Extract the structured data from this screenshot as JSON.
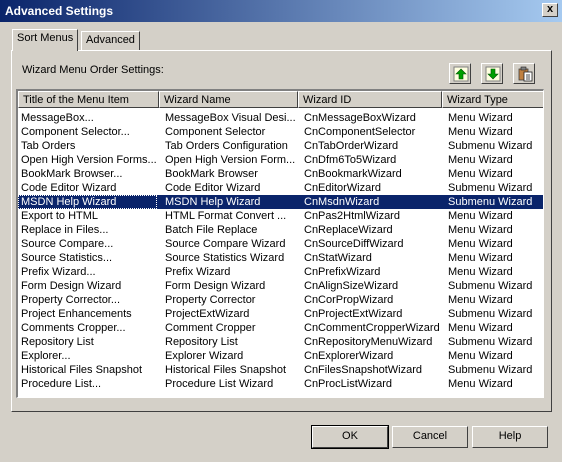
{
  "window": {
    "title": "Advanced Settings",
    "close_glyph": "x"
  },
  "tabs": [
    {
      "label": "Sort Menus",
      "active": true
    },
    {
      "label": "Advanced",
      "active": false
    }
  ],
  "section_label": "Wizard Menu Order Settings:",
  "toolbar": {
    "icons": [
      "move-up-icon",
      "move-down-icon",
      "paste-icon"
    ]
  },
  "columns": [
    "Title of the Menu Item",
    "Wizard Name",
    "Wizard ID",
    "Wizard Type"
  ],
  "rows": [
    [
      "MessageBox...",
      "MessageBox Visual Desi...",
      "CnMessageBoxWizard",
      "Menu Wizard"
    ],
    [
      "Component Selector...",
      "Component Selector",
      "CnComponentSelector",
      "Menu Wizard"
    ],
    [
      "Tab Orders",
      "Tab Orders Configuration",
      "CnTabOrderWizard",
      "Submenu Wizard"
    ],
    [
      "Open High Version Forms...",
      "Open High Version Form...",
      "CnDfm6To5Wizard",
      "Menu Wizard"
    ],
    [
      "BookMark Browser...",
      "BookMark Browser",
      "CnBookmarkWizard",
      "Menu Wizard"
    ],
    [
      "Code Editor Wizard",
      "Code Editor Wizard",
      "CnEditorWizard",
      "Submenu Wizard"
    ],
    [
      "MSDN Help Wizard",
      "MSDN Help Wizard",
      "CnMsdnWizard",
      "Submenu Wizard"
    ],
    [
      "Export to HTML",
      "HTML Format Convert ...",
      "CnPas2HtmlWizard",
      "Menu Wizard"
    ],
    [
      "Replace in Files...",
      "Batch File Replace",
      "CnReplaceWizard",
      "Menu Wizard"
    ],
    [
      "Source Compare...",
      "Source Compare Wizard",
      "CnSourceDiffWizard",
      "Menu Wizard"
    ],
    [
      "Source Statistics...",
      "Source Statistics Wizard",
      "CnStatWizard",
      "Menu Wizard"
    ],
    [
      "Prefix Wizard...",
      "Prefix Wizard",
      "CnPrefixWizard",
      "Menu Wizard"
    ],
    [
      "Form Design Wizard",
      "Form Design Wizard",
      "CnAlignSizeWizard",
      "Submenu Wizard"
    ],
    [
      "Property Corrector...",
      "Property Corrector",
      "CnCorPropWizard",
      "Menu Wizard"
    ],
    [
      "Project Enhancements",
      "ProjectExtWizard",
      "CnProjectExtWizard",
      "Submenu Wizard"
    ],
    [
      "Comments Cropper...",
      "Comment Cropper",
      "CnCommentCropperWizard",
      "Menu Wizard"
    ],
    [
      "Repository List",
      "Repository List",
      "CnRepositoryMenuWizard",
      "Submenu Wizard"
    ],
    [
      "Explorer...",
      "Explorer Wizard",
      "CnExplorerWizard",
      "Menu Wizard"
    ],
    [
      "Historical Files Snapshot",
      "Historical Files Snapshot",
      "CnFilesSnapshotWizard",
      "Submenu Wizard"
    ],
    [
      "Procedure List...",
      "Procedure List Wizard",
      "CnProcListWizard",
      "Menu Wizard"
    ]
  ],
  "selected_row": 6,
  "buttons": {
    "ok": "OK",
    "cancel": "Cancel",
    "help": "Help"
  },
  "colors": {
    "face": "#d4d0c8",
    "title_start": "#0a246a",
    "title_end": "#a6caf0",
    "selection": "#0a246a",
    "arrow_green": "#00a000"
  }
}
